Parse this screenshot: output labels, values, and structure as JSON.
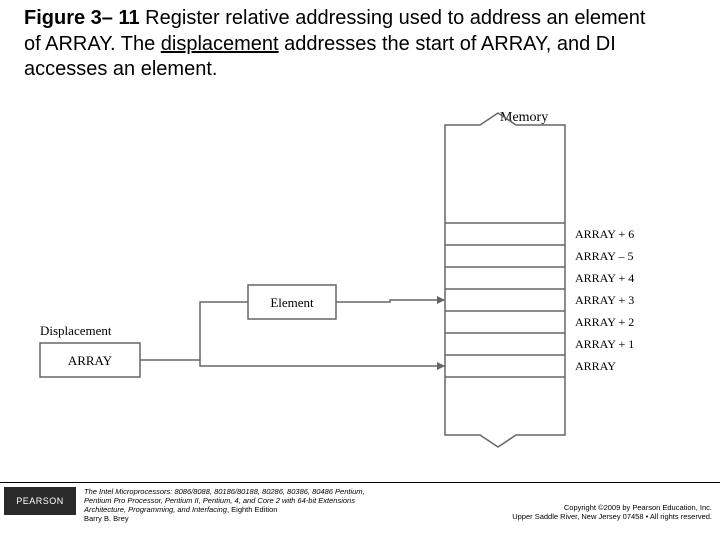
{
  "figure": {
    "number": "Figure 3– 11",
    "caption_before": "  Register relative addressing used to address an element of ARRAY. The ",
    "underlined": "displacement",
    "caption_after": " addresses the start of ARRAY, and DI accesses an element."
  },
  "diagram": {
    "memory_header": "Memory",
    "displacement_label": "Displacement",
    "array_box": "ARRAY",
    "element_box": "Element",
    "rows": [
      "ARRAY + 6",
      "ARRAY – 5",
      "ARRAY + 4",
      "ARRAY + 3",
      "ARRAY + 2",
      "ARRAY + 1",
      "ARRAY"
    ]
  },
  "footer": {
    "logo": "PEARSON",
    "book_line1": "The Intel Microprocessors: 8086/8088, 80186/80188, 80286, 80386, 80486 Pentium,",
    "book_line2": "Pentium Pro Processor, Pentium II, Pentium, 4, and Core 2 with 64-bit Extensions",
    "book_line3": "Architecture, Programming, and Interfacing",
    "book_line3_suffix": ", Eighth Edition",
    "author": "Barry B. Brey",
    "copyright_line1": "Copyright ©2009 by Pearson Education, Inc.",
    "copyright_line2": "Upper Saddle River, New Jersey 07458 • All rights reserved."
  }
}
